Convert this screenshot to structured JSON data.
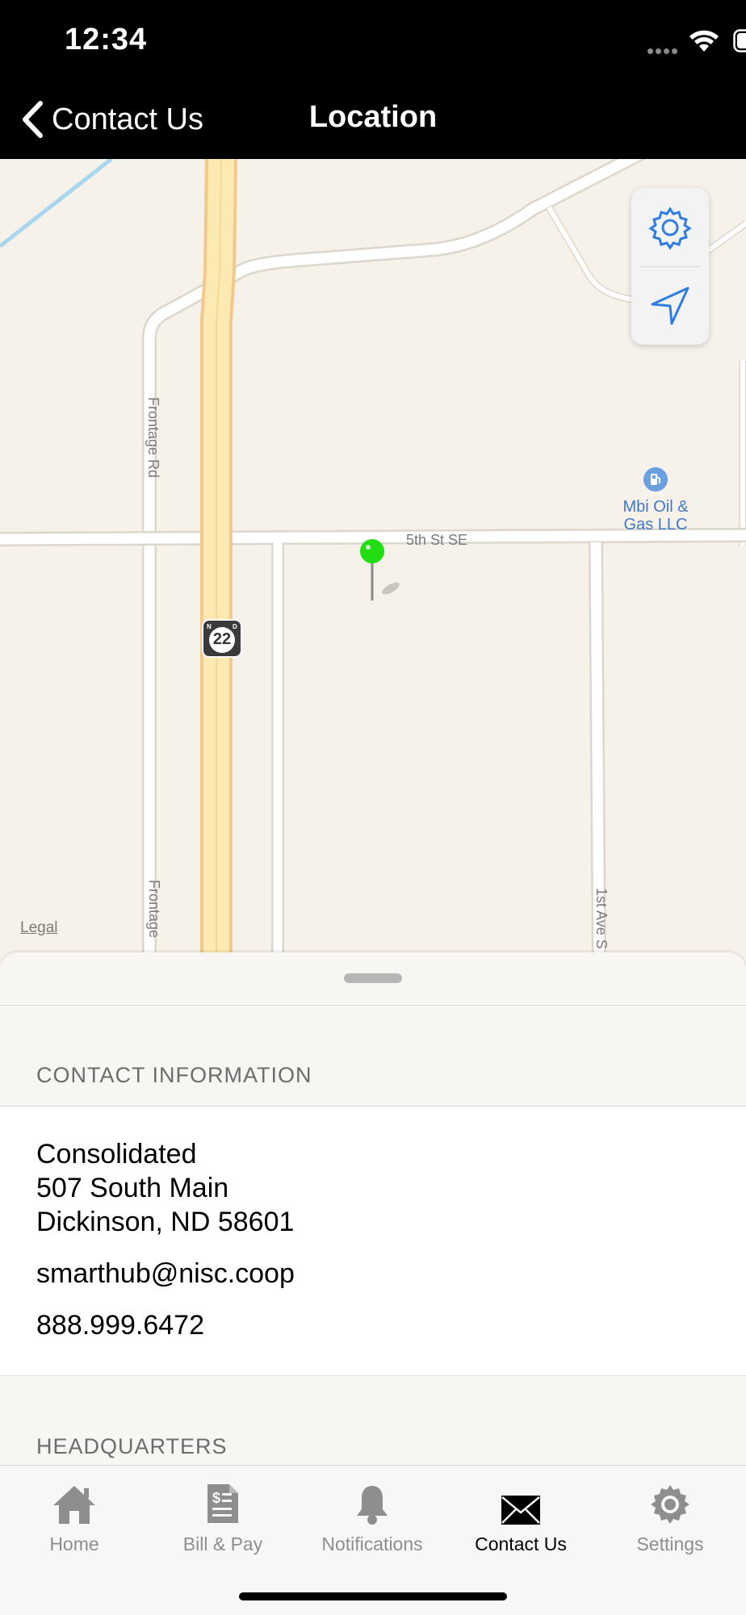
{
  "status_bar": {
    "time": "12:34"
  },
  "nav": {
    "back_label": "Contact Us",
    "title": "Location"
  },
  "map": {
    "streets": {
      "frontage_rd_top": "Frontage Rd",
      "frontage_rd_bottom": "Frontage",
      "fifth_st": "5th St SE",
      "first_ave": "1st Ave S"
    },
    "highway_shield": "22",
    "poi_name_line1": "Mbi Oil &",
    "poi_name_line2": "Gas LLC",
    "legal_link": "Legal",
    "pin_color": "#22dd11",
    "accent_color": "#2f7de1"
  },
  "contact": {
    "section_title": "CONTACT INFORMATION",
    "company": "Consolidated",
    "address_line1": "507 South Main",
    "address_line2": "Dickinson, ND 58601",
    "email": "smarthub@nisc.coop",
    "phone": "888.999.6472"
  },
  "headquarters": {
    "section_title": "HEADQUARTERS"
  },
  "tabs": [
    {
      "label": "Home",
      "icon": "home-icon",
      "active": false
    },
    {
      "label": "Bill & Pay",
      "icon": "bill-icon",
      "active": false
    },
    {
      "label": "Notifications",
      "icon": "bell-icon",
      "active": false
    },
    {
      "label": "Contact Us",
      "icon": "envelope-icon",
      "active": true
    },
    {
      "label": "Settings",
      "icon": "gear-icon",
      "active": false
    }
  ]
}
